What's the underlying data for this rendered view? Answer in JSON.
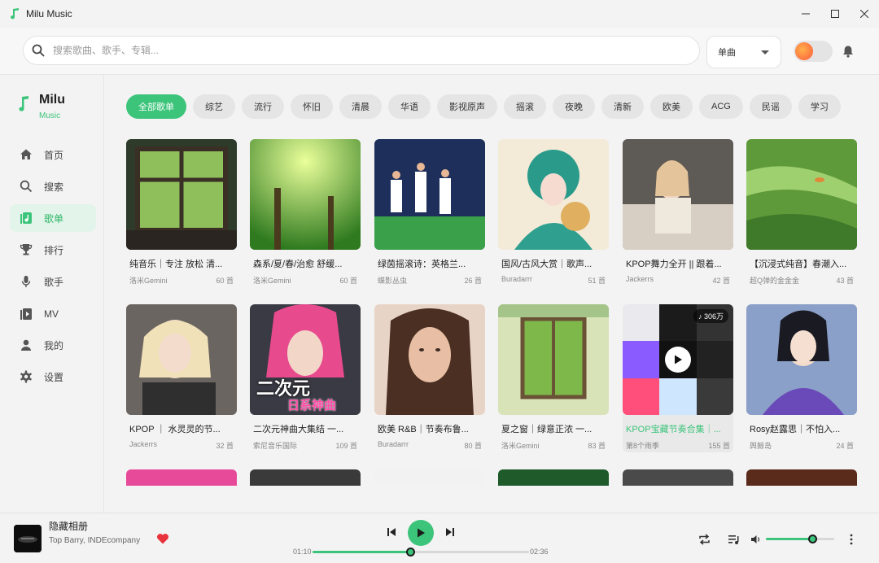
{
  "window": {
    "title": "Milu Music"
  },
  "search": {
    "placeholder": "搜索歌曲、歌手、专辑..."
  },
  "search_type": {
    "selected": "单曲"
  },
  "brand": {
    "name": "Milu",
    "subtitle": "Music"
  },
  "colors": {
    "accent": "#3cc47a",
    "heart": "#e8323c"
  },
  "nav": [
    {
      "label": "首页",
      "icon": "home-icon"
    },
    {
      "label": "搜索",
      "icon": "search-icon"
    },
    {
      "label": "歌单",
      "icon": "playlist-icon",
      "active": true
    },
    {
      "label": "排行",
      "icon": "trophy-icon"
    },
    {
      "label": "歌手",
      "icon": "microphone-icon"
    },
    {
      "label": "MV",
      "icon": "video-icon"
    },
    {
      "label": "我的",
      "icon": "user-icon"
    },
    {
      "label": "设置",
      "icon": "gear-icon"
    }
  ],
  "categories": [
    "全部歌单",
    "综艺",
    "流行",
    "怀旧",
    "清晨",
    "华语",
    "影视原声",
    "摇滚",
    "夜晚",
    "清新",
    "欧美",
    "ACG",
    "民谣",
    "学习"
  ],
  "active_category": 0,
  "playlists": [
    {
      "title": "纯音乐｜专注 放松 清...",
      "author": "洛米Gemini",
      "count": "60 首"
    },
    {
      "title": "森系/夏/春/治愈 舒缓...",
      "author": "洛米Gemini",
      "count": "60 首"
    },
    {
      "title": "绿茵摇滚诗：英格兰...",
      "author": "蝶影丛虫",
      "count": "26 首"
    },
    {
      "title": "国风/古风大赏｜歌声...",
      "author": "Buradarrr",
      "count": "51 首"
    },
    {
      "title": "KPOP舞力全开 || 跟着...",
      "author": "Jackerrs",
      "count": "42 首"
    },
    {
      "title": "【沉浸式纯音】春潮入...",
      "author": "超Q弹的金金金",
      "count": "43 首"
    },
    {
      "title": "KPOP ｜ 水灵灵的节...",
      "author": "Jackerrs",
      "count": "32 首"
    },
    {
      "title": "二次元神曲大集结 一...",
      "author": "索尼音乐国际",
      "count": "109 首",
      "cover_text": "二次元",
      "cover_text2": "日系神曲"
    },
    {
      "title": "欧美 R&B｜节奏布鲁...",
      "author": "Buradarrr",
      "count": "80 首"
    },
    {
      "title": "夏之窗｜绿意正浓 一...",
      "author": "洛米Gemini",
      "count": "83 首"
    },
    {
      "title": "KPOP宝藏节奏合集｜...",
      "author": "第8个雨季",
      "count": "155 首",
      "plays": "306万",
      "hover": true
    },
    {
      "title": "Rosy赵露思｜不怕入...",
      "author": "舆鲸岛",
      "count": "24 首"
    }
  ],
  "now_playing": {
    "title": "隐藏相册",
    "artist": "Top Barry, INDEcompany",
    "current": "01:10",
    "total": "02:36",
    "progress": 0.45,
    "liked": true
  },
  "volume": 0.68
}
